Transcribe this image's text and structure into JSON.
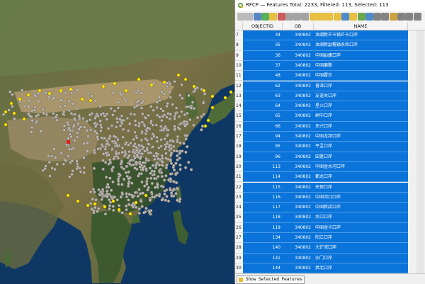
{
  "window": {
    "title": "RFCP — Features Total: 2233, Filtered: 113, Selected: 113"
  },
  "colors": {
    "selection": "#0a74da",
    "selected_point": "#ffe800",
    "point": "#bdb7ae",
    "highlight_point": "#e02020"
  },
  "toolbar": {
    "icons": [
      "pencil-icon",
      "multi-edit-icon",
      "save-icon",
      "reload-icon",
      "add-feature-icon",
      "delete-icon",
      "cut-icon",
      "copy-icon",
      "paste-icon",
      "expression-select-icon",
      "select-all-icon",
      "invert-selection-icon",
      "deselect-icon",
      "filter-icon",
      "move-top-icon",
      "pan-to-icon",
      "zoom-to-icon",
      "new-field-icon",
      "delete-field-icon",
      "field-calc-icon",
      "conditional-format-icon",
      "dock-icon",
      "actions-icon"
    ]
  },
  "table": {
    "columns": [
      "OBJECTID",
      "GB",
      "NAME"
    ],
    "rows": [
      {
        "n": "7",
        "oid": "34",
        "gb": "340802",
        "name": "油湖新芒卡镇芒卡口岸"
      },
      {
        "n": "8",
        "oid": "35",
        "gb": "340802",
        "name": "油湖新勐糯镇永和口岸"
      },
      {
        "n": "9",
        "oid": "36",
        "gb": "340802",
        "name": "中国勐康口岸"
      },
      {
        "n": "10",
        "oid": "37",
        "gb": "340802",
        "name": "中国磨憨"
      },
      {
        "n": "11",
        "oid": "48",
        "gb": "340802",
        "name": "中国霍尔"
      },
      {
        "n": "12",
        "oid": "62",
        "gb": "340802",
        "name": "普洱口岸"
      },
      {
        "n": "13",
        "oid": "63",
        "gb": "340802",
        "name": "友谊关口岸"
      },
      {
        "n": "14",
        "oid": "64",
        "gb": "340802",
        "name": "星火口岸"
      },
      {
        "n": "15",
        "oid": "65",
        "gb": "340802",
        "name": "峒中口岸"
      },
      {
        "n": "16",
        "oid": "66",
        "gb": "340802",
        "name": "东兴口岸"
      },
      {
        "n": "17",
        "oid": "94",
        "gb": "340802",
        "name": "中国龙邦口岸"
      },
      {
        "n": "18",
        "oid": "95",
        "gb": "340802",
        "name": "平孟口岸"
      },
      {
        "n": "19",
        "oid": "96",
        "gb": "340802",
        "name": "田蓬口岸"
      },
      {
        "n": "20",
        "oid": "113",
        "gb": "340802",
        "name": "中国金水河口岸"
      },
      {
        "n": "21",
        "oid": "114",
        "gb": "340802",
        "name": "都龙口岸"
      },
      {
        "n": "22",
        "oid": "115",
        "gb": "340802",
        "name": "天保口岸"
      },
      {
        "n": "23",
        "oid": "116",
        "gb": "340802",
        "name": "中国河口口岸"
      },
      {
        "n": "24",
        "oid": "117",
        "gb": "340802",
        "name": "中国新店口岸"
      },
      {
        "n": "25",
        "oid": "118",
        "gb": "340802",
        "name": "水口口岸"
      },
      {
        "n": "26",
        "oid": "119",
        "gb": "340802",
        "name": "中国金卡口岸"
      },
      {
        "n": "27",
        "oid": "134",
        "gb": "340802",
        "name": "阳江口岸"
      },
      {
        "n": "28",
        "oid": "140",
        "gb": "340802",
        "name": "大铲湾口岸"
      },
      {
        "n": "29",
        "oid": "141",
        "gb": "340802",
        "name": "沙门口岸"
      },
      {
        "n": "30",
        "oid": "144",
        "gb": "340802",
        "name": "拱北口岸"
      }
    ]
  },
  "bottom": {
    "show_label": "Show Selected Features"
  }
}
